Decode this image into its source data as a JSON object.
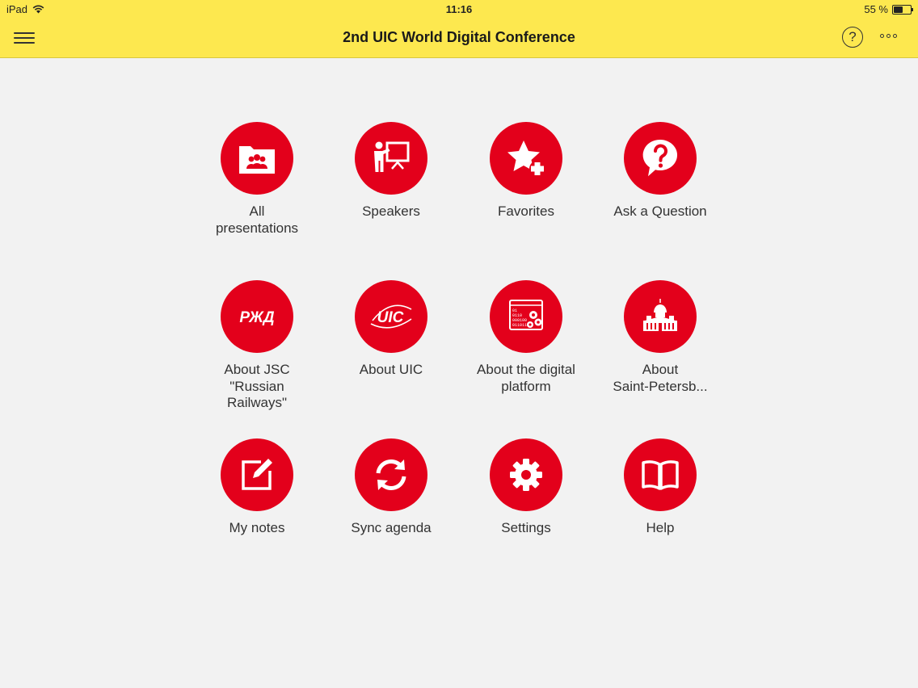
{
  "status_bar": {
    "device": "iPad",
    "time": "11:16",
    "battery": "55 %",
    "battery_level": 0.55
  },
  "header": {
    "title": "2nd UIC World Digital Conference",
    "menu_icon": "hamburger-menu-icon",
    "help_icon": "question-circle-icon",
    "help_glyph": "?",
    "more_icon": "more-dots-icon"
  },
  "colors": {
    "header_bg": "#fde84f",
    "accent_red": "#e3001b",
    "page_bg": "#f2f2f2"
  },
  "tiles": [
    {
      "label": "All\npresentations",
      "icon": "presentations-folder-icon"
    },
    {
      "label": "Speakers",
      "icon": "speaker-presenter-icon"
    },
    {
      "label": "Favorites",
      "icon": "star-plus-icon"
    },
    {
      "label": "Ask a Question",
      "icon": "question-bubble-icon"
    },
    {
      "label": "About JSC\n\"Russian\nRailways\"",
      "icon": "rzd-logo-icon",
      "logo_text": "РЖД"
    },
    {
      "label": "About UIC",
      "icon": "uic-logo-icon",
      "logo_text": "UIC"
    },
    {
      "label": "About the digital\nplatform",
      "icon": "digital-platform-icon",
      "binary_lines": [
        "01",
        "0110",
        "000100",
        "0110110"
      ]
    },
    {
      "label": "About\nSaint-Petersb...",
      "icon": "cathedral-icon"
    },
    {
      "label": "My notes",
      "icon": "edit-note-icon"
    },
    {
      "label": "Sync agenda",
      "icon": "sync-icon"
    },
    {
      "label": "Settings",
      "icon": "gear-icon"
    },
    {
      "label": "Help",
      "icon": "open-book-icon"
    }
  ]
}
